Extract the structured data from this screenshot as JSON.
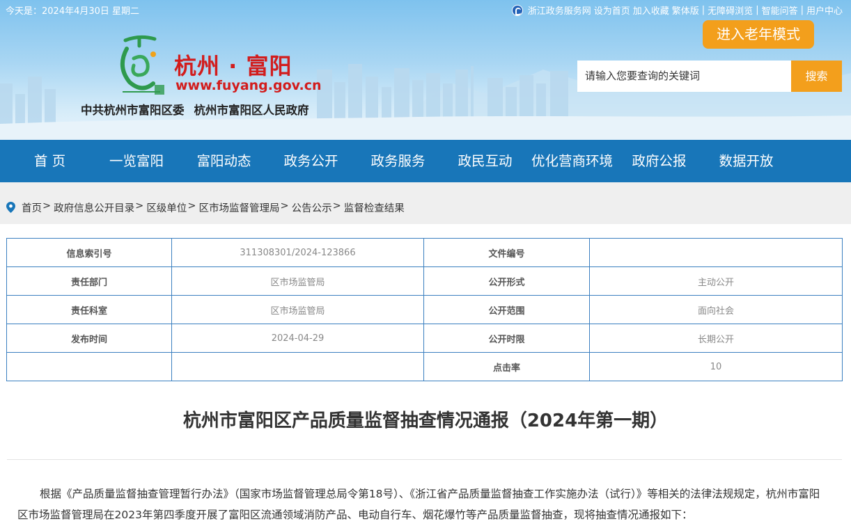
{
  "topbar": {
    "date_text": "今天是：2024年4月30日 星期二",
    "links": [
      "浙江政务服务网",
      "设为首页",
      "加入收藏",
      "繁体版",
      "|",
      "无障碍浏览",
      "|",
      "智能问答",
      "|",
      "用户中心"
    ],
    "zj_icon": "zjzwfw-logo-icon"
  },
  "header": {
    "site_title": "杭州 · 富阳",
    "site_url": "www.fuyang.gov.cn",
    "org_left": "中共杭州市富阳区委",
    "org_right": "杭州市富阳区人民政府",
    "elder_mode": "进入老年模式",
    "search_placeholder": "请输入您要查询的关键词",
    "search_button": "搜索",
    "logo_icon": "fuyang-logo-icon"
  },
  "nav": [
    "首 页",
    "一览富阳",
    "富阳动态",
    "政务公开",
    "政务服务",
    "政民互动",
    "优化营商环境",
    "政府公报",
    "数据开放"
  ],
  "breadcrumb": {
    "icon": "location-pin-icon",
    "items": [
      "首页",
      "政府信息公开目录",
      "区级单位",
      "区市场监督管理局",
      "公告公示",
      "监督检查结果"
    ],
    "separator": ">"
  },
  "info": {
    "rows": [
      {
        "k1": "信息索引号",
        "v1": "311308301/2024-123866",
        "k2": "文件编号",
        "v2": ""
      },
      {
        "k1": "责任部门",
        "v1": "区市场监管局",
        "k2": "公开形式",
        "v2": "主动公开"
      },
      {
        "k1": "责任科室",
        "v1": "区市场监管局",
        "k2": "公开范围",
        "v2": "面向社会"
      },
      {
        "k1": "发布时间",
        "v1": "2024-04-29",
        "k2": "公开时限",
        "v2": "长期公开"
      },
      {
        "k1": "",
        "v1": "",
        "k2": "点击率",
        "v2": "10"
      }
    ]
  },
  "article": {
    "title": "杭州市富阳区产品质量监督抽查情况通报（2024年第一期）",
    "paragraph": "根据《产品质量监督抽查管理暂行办法》（国家市场监督管理总局令第18号）、《浙江省产品质量监督抽查工作实施办法（试行）》等相关的法律法规规定，杭州市富阳区市场监督管理局在2023年第四季度开展了富阳区流通领域消防产品、电动自行车、烟花爆竹等产品质量监督抽查，现将抽查情况通报如下："
  }
}
